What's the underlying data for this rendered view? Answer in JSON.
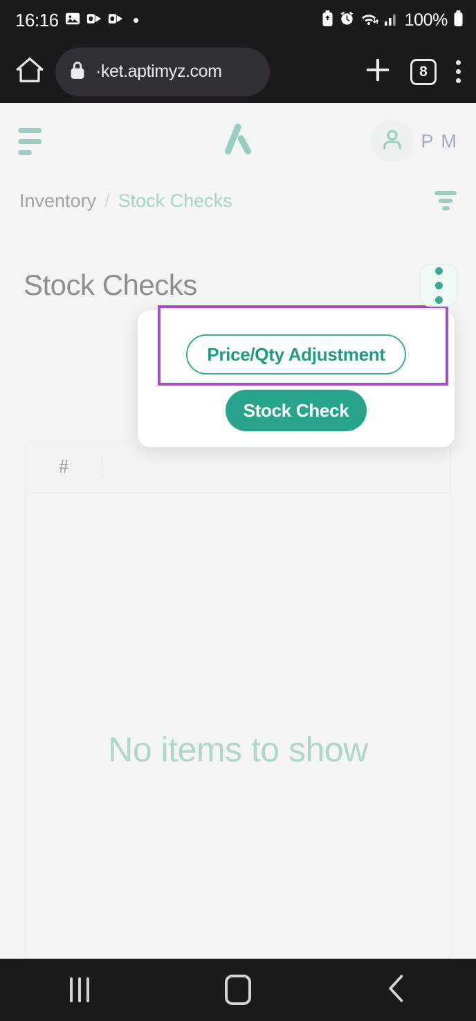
{
  "status_bar": {
    "time": "16:16",
    "left_icons": [
      "photo-icon",
      "outlook-icon",
      "outlook-icon",
      "dot-indicator"
    ],
    "right_icons": [
      "battery-saver-icon",
      "alarm-icon",
      "wifi-icon",
      "signal-icon"
    ],
    "battery_percent": "100%"
  },
  "browser": {
    "home_icon": "home-icon",
    "lock_icon": "lock-icon",
    "url": "·ket.aptimyz.com",
    "new_tab_icon": "plus-icon",
    "tab_count": "8",
    "menu_icon": "kebab-menu-icon"
  },
  "app_header": {
    "menu_icon": "hamburger-menu-icon",
    "logo": "aptimyz-logo",
    "avatar_icon": "person-icon",
    "profile_initials": "P M"
  },
  "breadcrumb": {
    "root": "Inventory",
    "separator": "/",
    "current": "Stock Checks",
    "filter_icon": "filter-icon"
  },
  "main": {
    "page_title": "Stock Checks",
    "actions_menu_icon": "kebab-menu-icon",
    "table": {
      "columns": [
        "#"
      ],
      "rows": [],
      "empty_message": "No items to show"
    }
  },
  "popup_menu": {
    "items": [
      {
        "label": "Price/Qty Adjustment",
        "style": "outline",
        "highlighted": true
      },
      {
        "label": "Stock Check",
        "style": "filled",
        "highlighted": false
      }
    ]
  },
  "nav_bar": {
    "recents_icon": "recents-icon",
    "home_icon": "home-square-icon",
    "back_icon": "back-chevron-icon"
  },
  "colors": {
    "brand_teal": "#3aa893",
    "filled_button": "#27a58c",
    "highlight_purple": "#a34fc4",
    "empty_text": "#62bda6",
    "initials_blue": "#3d5a8a"
  }
}
